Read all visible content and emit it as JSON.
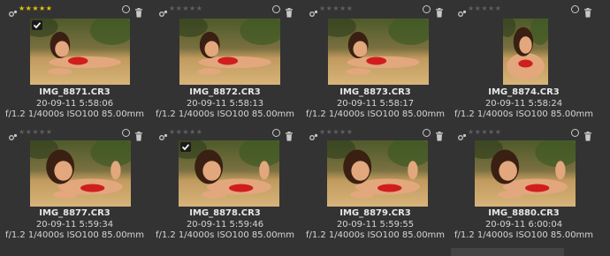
{
  "thumbnails": [
    {
      "filename": "IMG_8871.CR3",
      "datetime": "20-09-11 5:58:06",
      "exif": "f/1.2 1/4000s ISO100 85.00mm",
      "stars": "★★★★★",
      "rating": 5,
      "selected": true,
      "pose": "wide-lying"
    },
    {
      "filename": "IMG_8872.CR3",
      "datetime": "20-09-11 5:58:13",
      "exif": "f/1.2 1/4000s ISO100 85.00mm",
      "stars": "★★★★★",
      "rating": 0,
      "selected": false,
      "pose": "wide-lying"
    },
    {
      "filename": "IMG_8873.CR3",
      "datetime": "20-09-11 5:58:17",
      "exif": "f/1.2 1/4000s ISO100 85.00mm",
      "stars": "★★★★★",
      "rating": 0,
      "selected": false,
      "pose": "wide-lying"
    },
    {
      "filename": "IMG_8874.CR3",
      "datetime": "20-09-11 5:58:24",
      "exif": "f/1.2 1/4000s ISO100 85.00mm",
      "stars": "★★★★★",
      "rating": 0,
      "selected": false,
      "pose": "portrait-vertical"
    },
    {
      "filename": "IMG_8877.CR3",
      "datetime": "20-09-11 5:59:34",
      "exif": "f/1.2 1/4000s ISO100 85.00mm",
      "stars": "★★★★★",
      "rating": 0,
      "selected": false,
      "pose": "close-lying"
    },
    {
      "filename": "IMG_8878.CR3",
      "datetime": "20-09-11 5:59:46",
      "exif": "f/1.2 1/4000s ISO100 85.00mm",
      "stars": "★★★★★",
      "rating": 0,
      "selected": true,
      "pose": "close-lying"
    },
    {
      "filename": "IMG_8879.CR3",
      "datetime": "20-09-11 5:59:55",
      "exif": "f/1.2 1/4000s ISO100 85.00mm",
      "stars": "★★★★★",
      "rating": 0,
      "selected": false,
      "pose": "close-lying"
    },
    {
      "filename": "IMG_8880.CR3",
      "datetime": "20-09-11 6:00:04",
      "exif": "f/1.2 1/4000s ISO100 85.00mm",
      "stars": "★★★★★",
      "rating": 0,
      "selected": false,
      "pose": "close-lying"
    }
  ],
  "colors": {
    "background": "#333333",
    "star_rated": "#e6c400",
    "star_unrated": "#5f5f5f",
    "caption_text": "#d6d6d6",
    "sand": "#c9a56a",
    "foliage": "#3f5a24",
    "bikini": "#d01e1e",
    "skin": "#e3a77d",
    "hair": "#3a2012"
  },
  "icons": {
    "grouping": "grouping-icon",
    "altered": "altered-circle-icon",
    "delete": "trash-icon",
    "selected": "checkmark-icon"
  }
}
